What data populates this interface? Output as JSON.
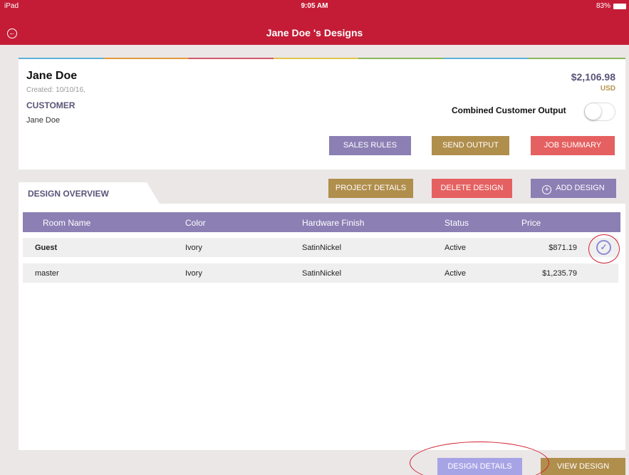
{
  "status_bar": {
    "device": "iPad",
    "time": "9:05 AM",
    "battery": "83%"
  },
  "header": {
    "title": "Jane Doe 's Designs"
  },
  "customer_card": {
    "name": "Jane Doe",
    "created": "Created: 10/10/16,",
    "customer_heading": "CUSTOMER",
    "customer_name": "Jane Doe",
    "total": "$2,106.98",
    "currency": "USD",
    "combined_output_label": "Combined Customer Output",
    "combined_output_on": false
  },
  "actions": {
    "sales_rules": "SALES RULES",
    "send_output": "SEND OUTPUT",
    "job_summary": "JOB SUMMARY",
    "project_details": "PROJECT DETAILS",
    "delete_design": "DELETE DESIGN",
    "add_design": "ADD DESIGN",
    "design_details": "DESIGN DETAILS",
    "view_design": "VIEW DESIGN"
  },
  "overview": {
    "tab_label": "DESIGN OVERVIEW",
    "columns": [
      "Room Name",
      "Color",
      "Hardware Finish",
      "Status",
      "Price"
    ],
    "rows": [
      {
        "room": "Guest",
        "color": "Ivory",
        "hardware": "SatinNickel",
        "status": "Active",
        "price": "$871.19",
        "selected": true
      },
      {
        "room": "master",
        "color": "Ivory",
        "hardware": "SatinNickel",
        "status": "Active",
        "price": "$1,235.79",
        "selected": false
      }
    ]
  },
  "colors": {
    "header_red": "#c41c36",
    "purple": "#8b7fb4",
    "gold": "#b08e4c",
    "red": "#e56060",
    "lavender": "#a7a4e6"
  }
}
